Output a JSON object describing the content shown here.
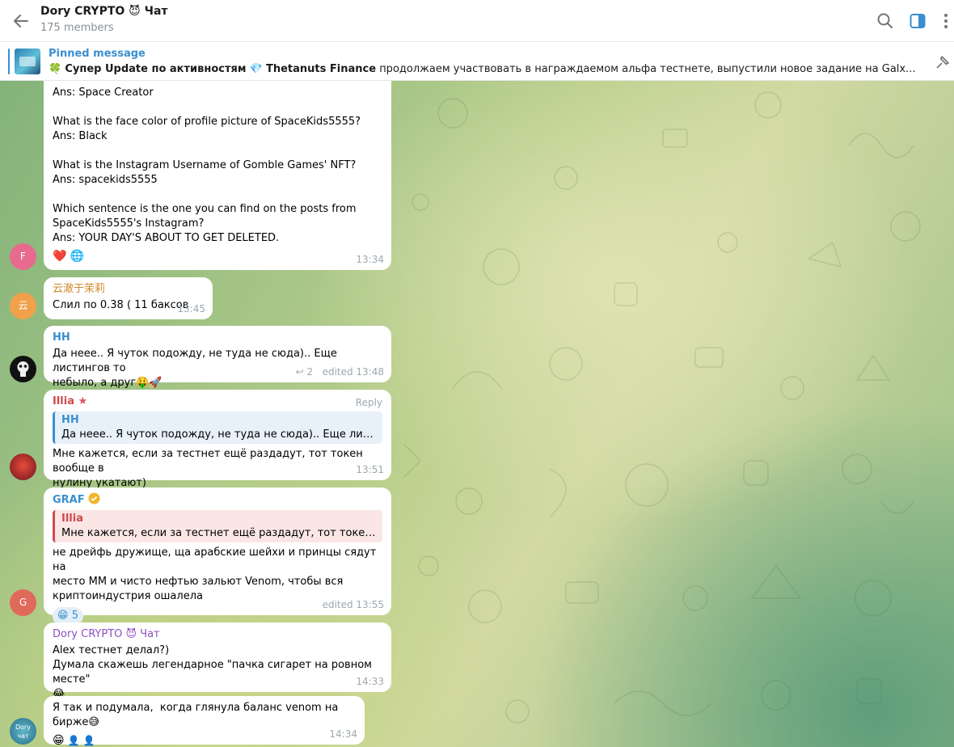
{
  "header": {
    "title": "Dory CRYPTO 😈 Чат",
    "members": "175 members"
  },
  "pinned": {
    "label": "Pinned message",
    "prefix_emoji": "🍀",
    "bold_part": "Супер Update по активностям",
    "gem_emoji": "💎",
    "bold_part2": "Thetanuts Finance",
    "rest": "продолжаем участвовать в награждаемом альфа тестнете, выпустили новое задание на Galxe, подробнее проек..."
  },
  "messages": [
    {
      "lines": [
        "Ans: Space Creator",
        "",
        "What is the face color of profile picture of SpaceKids5555?",
        "Ans: Black",
        "",
        "What is the Instagram Username of Gomble Games' NFT?",
        "Ans: spacekids5555",
        "",
        "Which sentence is the one you can find on the posts from",
        "SpaceKids5555's Instagram?",
        "Ans: YOUR DAY'S ABOUT TO GET DELETED."
      ],
      "reactions": [
        "❤️",
        "🌐"
      ],
      "time": "13:34",
      "avatar_letter": "F"
    },
    {
      "sender": "云澈于茉莉",
      "text": "Слил по 0.38 ( 11 баксов",
      "time": "13:45",
      "avatar_letter": "云"
    },
    {
      "sender": "HH",
      "lines": [
        "Да неее.. Я чуток подожду, не туда не сюда).. Еще листингов то",
        "небыло, а друг🤑🚀"
      ],
      "replies": "2",
      "time": "edited 13:48"
    },
    {
      "sender": "Illia",
      "reply_label": "Reply",
      "quote_name": "HH",
      "quote_text": "Да неее.. Я чуток подожду, не туда не сюда).. Еще листингов т...",
      "lines": [
        "Мне кажется, если за тестнет ещё раздадут, тот токен вообще в",
        "нулину укатают)"
      ],
      "time": "13:51"
    },
    {
      "sender": "GRAF",
      "quote_name": "Illia",
      "quote_text": "Мне кажется, если за тестнет ещё раздадут, тот токен вообщ...",
      "lines": [
        "не дрейфь дружище, ща арабские шейхи и принцы сядут на",
        "место ММ и чисто нефтью зальют Venom, чтобы вся",
        "криптоиндустрия ошалела"
      ],
      "reaction_emoji": "😁",
      "reaction_count": "5",
      "time": "edited 13:55",
      "avatar_letter": "G"
    },
    {
      "sender": "Dory CRYPTO 😈 Чат",
      "lines": [
        "Alex тестнет делал?)",
        "Думала скажешь легендарное \"пачка сигарет на ровном месте\"",
        "😂"
      ],
      "time": "14:33"
    },
    {
      "text": "Я так и подумала,  когда глянула баланс venom на бирже😅",
      "reactions": [
        "😁",
        "👤",
        "👤"
      ],
      "time": "14:34",
      "avatar_text": "Dory чат"
    }
  ],
  "colors": {
    "accent": "#3a8fd0",
    "sender_orange": "#d0882c",
    "sender_red": "#d04a4a",
    "sender_purple": "#8f4fc4"
  }
}
